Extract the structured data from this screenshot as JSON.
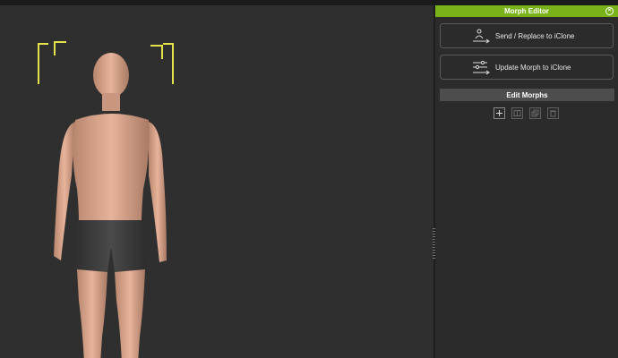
{
  "panel": {
    "title": "Morph Editor",
    "close_icon": "close-circle-icon",
    "buttons": [
      {
        "label": "Send / Replace to iClone",
        "icon": "person-send-icon"
      },
      {
        "label": "Update Morph to iClone",
        "icon": "sliders-send-icon"
      }
    ],
    "section": "Edit Morphs",
    "tools": [
      {
        "icon": "add-icon",
        "enabled": true
      },
      {
        "icon": "edit-morph-icon",
        "enabled": false
      },
      {
        "icon": "duplicate-icon",
        "enabled": false
      },
      {
        "icon": "delete-icon",
        "enabled": false
      }
    ]
  },
  "colors": {
    "accent": "#7ab317",
    "panel_bg": "#2b2b2b",
    "viewport_bg": "#2f2f2f",
    "bracket": "#e4e44a"
  }
}
